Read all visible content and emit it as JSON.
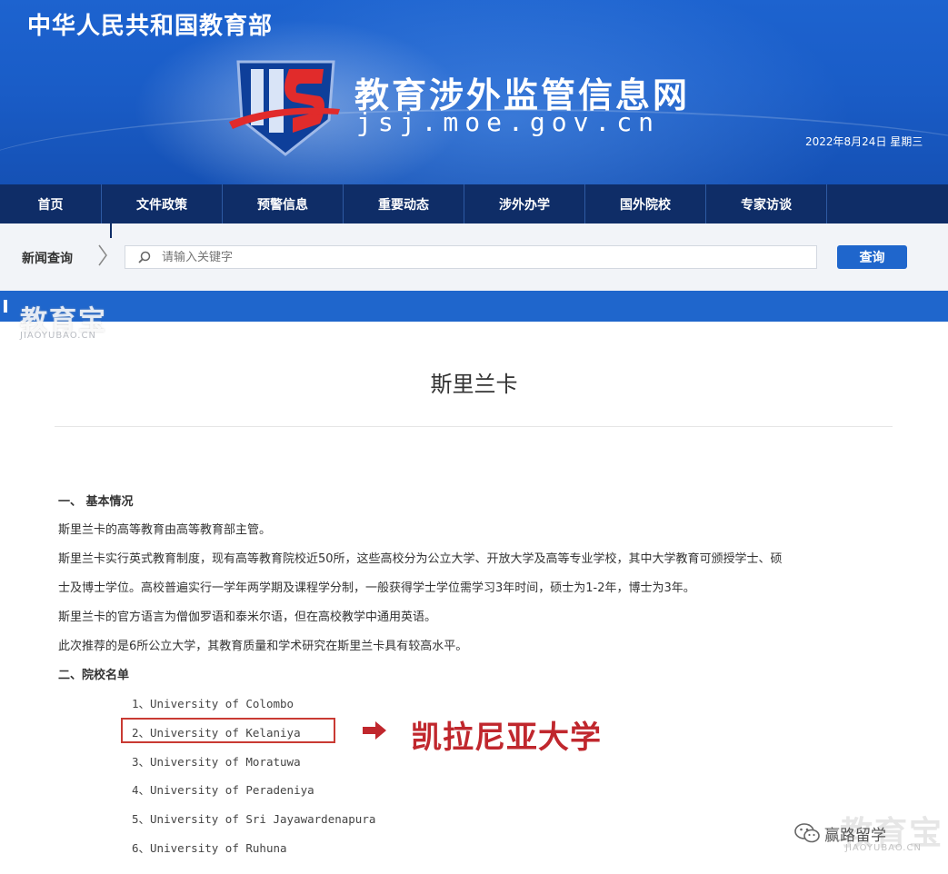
{
  "header": {
    "ministry": "中华人民共和国教育部",
    "site_title": "教育涉外监管信息网",
    "site_url": "jsj.moe.gov.cn",
    "date": "2022年8月24日  星期三"
  },
  "nav": {
    "items": [
      {
        "label": "首页"
      },
      {
        "label": "文件政策"
      },
      {
        "label": "预警信息"
      },
      {
        "label": "重要动态"
      },
      {
        "label": "涉外办学"
      },
      {
        "label": "国外院校"
      },
      {
        "label": "专家访谈"
      }
    ]
  },
  "search": {
    "label": "新闻查询",
    "placeholder": "请输入关键字",
    "button": "查询"
  },
  "watermark": {
    "brand": "教育宝",
    "domain": "JIAOYUBAO.CN",
    "account": "赢路留学"
  },
  "article": {
    "title": "斯里兰卡",
    "section1_heading": "一、 基本情况",
    "paragraphs": [
      "斯里兰卡的高等教育由高等教育部主管。",
      "斯里兰卡实行英式教育制度，现有高等教育院校近50所，这些高校分为公立大学、开放大学及高等专业学校，其中大学教育可颁授学士、硕",
      "士及博士学位。高校普遍实行一学年两学期及课程学分制，一般获得学士学位需学习3年时间，硕士为1-2年，博士为3年。",
      "斯里兰卡的官方语言为僧伽罗语和泰米尔语，但在高校教学中通用英语。",
      "此次推荐的是6所公立大学，其教育质量和学术研究在斯里兰卡具有较高水平。"
    ],
    "section2_heading": "二、院校名单",
    "universities": [
      "1、University of Colombo",
      "2、University of Kelaniya",
      "3、University of Moratuwa",
      "4、University of Peradeniya",
      "5、University of Sri Jayawardenapura",
      "6、University of Ruhuna"
    ],
    "callout": "凯拉尼亚大学"
  },
  "colors": {
    "banner_blue": "#1a5dc8",
    "nav_navy": "#0f2d67",
    "accent_blue": "#1f66cc",
    "highlight_red": "#c93a33"
  },
  "icons": {
    "logo": "jsj-shield-logo",
    "search": "search-icon",
    "chevron": "chevron-right-icon",
    "arrow": "arrow-right-icon",
    "wechat": "wechat-icon"
  }
}
